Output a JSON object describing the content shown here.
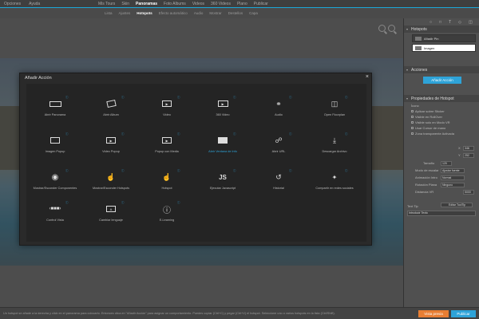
{
  "topbar": {
    "left": [
      "Opciones",
      "Ayuda"
    ],
    "nav": [
      "Mis Tours",
      "Skin",
      "Panoramas",
      "Foto Albums",
      "Videos",
      "360 Videos",
      "Plano",
      "Publicar"
    ],
    "active_nav": "Panoramas"
  },
  "subbar": {
    "tabs": [
      "Lista",
      "Ajustes",
      "Hotspots",
      "Efecto automático",
      "Audio",
      "Mostrar",
      "Destellos",
      "Capa"
    ],
    "active_tab": "Hotspots"
  },
  "modal": {
    "title": "Añadir Acción",
    "close": "×",
    "actions": [
      {
        "label": "Abrir Panorama",
        "icon": "panorama-icon"
      },
      {
        "label": "Abrir Album",
        "icon": "album-icon"
      },
      {
        "label": "Video",
        "icon": "video-icon"
      },
      {
        "label": "360 Video",
        "icon": "video-360-icon"
      },
      {
        "label": "Audio",
        "icon": "headphones-icon"
      },
      {
        "label": "Open Floorplan",
        "icon": "floorplan-icon"
      },
      {
        "label": "Imagen Popup",
        "icon": "image-popup-icon"
      },
      {
        "label": "Video Popup",
        "icon": "video-popup-icon"
      },
      {
        "label": "Popup con Media",
        "icon": "media-popup-icon"
      },
      {
        "label": "Abrir Ventana de Info",
        "icon": "info-window-icon",
        "selected": true
      },
      {
        "label": "Abrir URL",
        "icon": "link-icon"
      },
      {
        "label": "Descargar Archivo",
        "icon": "download-icon"
      },
      {
        "label": "Mostrar/Esconder Componentes",
        "icon": "eye-icon"
      },
      {
        "label": "Mostrar/Esconder Hotspots",
        "icon": "hotspot-toggle-icon"
      },
      {
        "label": "Hotspot",
        "icon": "hotspot-icon"
      },
      {
        "label": "Ejecutar Javascript",
        "icon": "javascript-icon",
        "icon_text": "JS"
      },
      {
        "label": "Historial",
        "icon": "history-icon"
      },
      {
        "label": "Compartir en redes sociales",
        "icon": "twitter-icon"
      },
      {
        "label": "Control Vista",
        "icon": "view-control-icon"
      },
      {
        "label": "Cambiar lenguaje",
        "icon": "language-icon"
      },
      {
        "label": "E-Learning",
        "icon": "elearning-icon"
      }
    ]
  },
  "right_panel": {
    "hotspots_title": "Hotspots",
    "hotspots": [
      "Añadir Pin",
      "Imagen"
    ],
    "actions_title": "Acciones",
    "add_action": "Añadir Acción",
    "props_title": "Propiedades de Hotspot",
    "props": [
      "Ícono",
      "Aplicar sobre Sticker",
      "Visible en RollOver",
      "Visible solo en Modo VR",
      "Usar Cursor de mano",
      "Zona transparente Activada"
    ],
    "field_labels": [
      "X",
      "Y",
      "Tamaño",
      "Modo de escalar",
      "Animación Intro",
      "Rotación Plana",
      "Distancia VR"
    ],
    "field_values": [
      "346",
      "252",
      "120",
      "Ajustar fuente",
      "Normal",
      "Ninguno",
      "5000"
    ],
    "tooltip_label": "Text Tip",
    "tooltip_btn": "Editar ToolTip",
    "tooltip_value": "Introducir Texto"
  },
  "bottom": {
    "message": "Un hotspot se añade a la derecha y click en el panorama para colocarlo. Entonces clica en \"Añadir Acción\" para asignar un comportamiento. Puedes copiar (Ctrl+C) y pegar (Ctrl+V) el hotspot. Seleccione uno o varios hotspots en la lista (Ctrl/Shift).",
    "preview": "Vista previa",
    "publish": "Publicar"
  }
}
